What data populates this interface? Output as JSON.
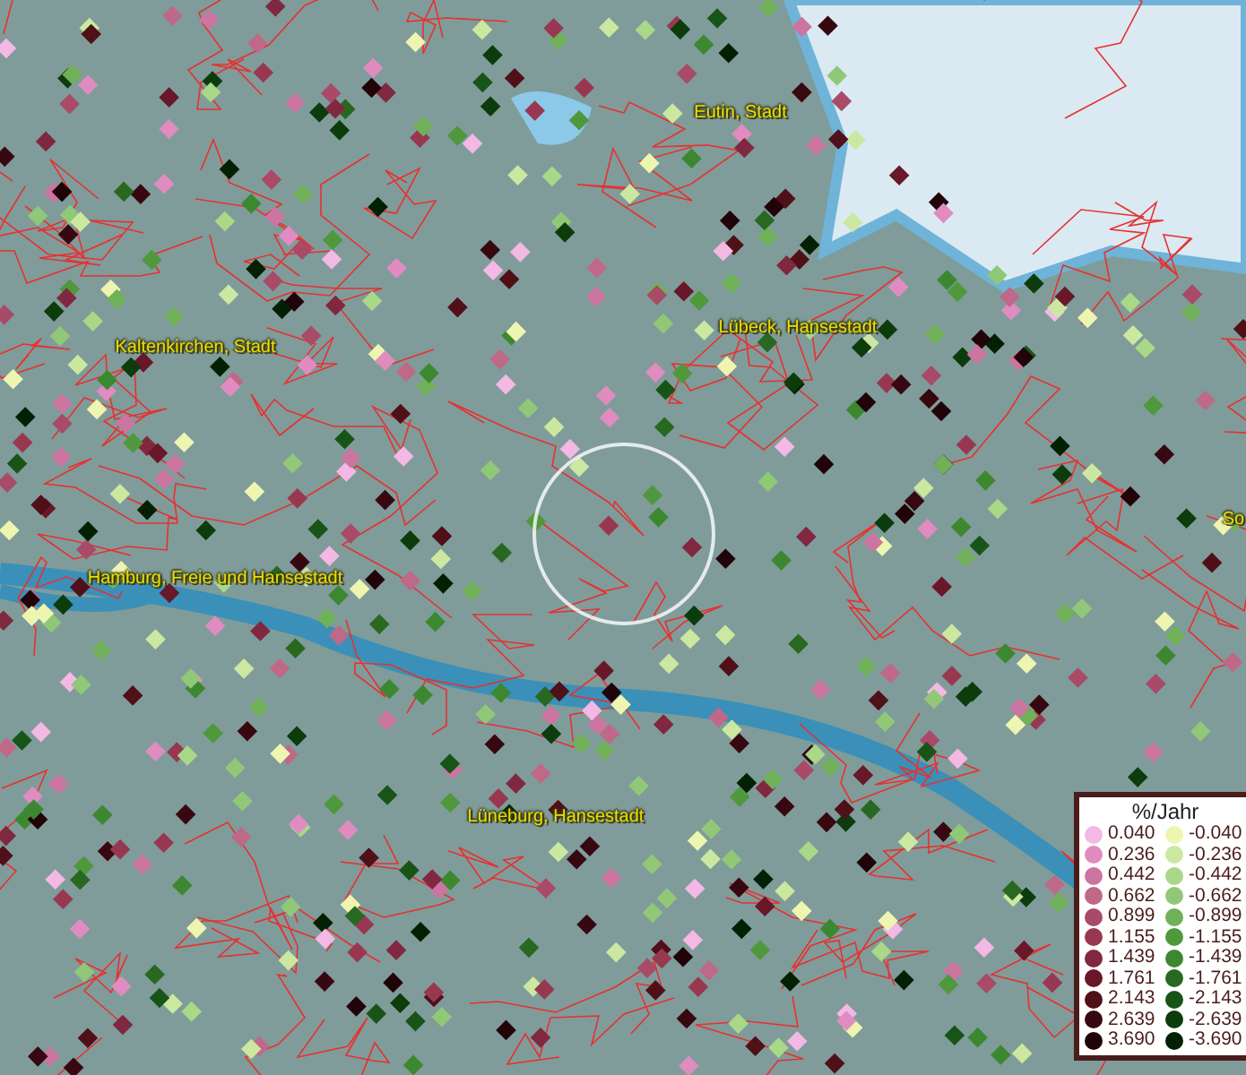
{
  "map": {
    "places": [
      {
        "name": "Eutin, Stadt"
      },
      {
        "name": "Lübeck, Hansestadt"
      },
      {
        "name": "Kaltenkirchen, Stadt"
      },
      {
        "name": "Hamburg, Freie und Hansestadt"
      },
      {
        "name": "Lüneburg, Hansestadt"
      },
      {
        "name": "So"
      }
    ]
  },
  "legend": {
    "title": "%/Jahr",
    "rows": [
      {
        "left": {
          "value": "0.040",
          "color": "#f4b8e4"
        },
        "right": {
          "value": "-0.040",
          "color": "#eef5b0"
        }
      },
      {
        "left": {
          "value": "0.236",
          "color": "#e08cc0"
        },
        "right": {
          "value": "-0.236",
          "color": "#cce8a0"
        }
      },
      {
        "left": {
          "value": "0.442",
          "color": "#cc75a0"
        },
        "right": {
          "value": "-0.442",
          "color": "#a8d888"
        }
      },
      {
        "left": {
          "value": "0.662",
          "color": "#c06888"
        },
        "right": {
          "value": "-0.662",
          "color": "#90c878"
        }
      },
      {
        "left": {
          "value": "0.899",
          "color": "#a84a68"
        },
        "right": {
          "value": "-0.899",
          "color": "#70b058"
        }
      },
      {
        "left": {
          "value": "1.155",
          "color": "#983850"
        },
        "right": {
          "value": "-1.155",
          "color": "#50983c"
        }
      },
      {
        "left": {
          "value": "1.439",
          "color": "#802840"
        },
        "right": {
          "value": "-1.439",
          "color": "#3c8830"
        }
      },
      {
        "left": {
          "value": "1.761",
          "color": "#681828"
        },
        "right": {
          "value": "-1.761",
          "color": "#286820"
        }
      },
      {
        "left": {
          "value": "2.143",
          "color": "#501018"
        },
        "right": {
          "value": "-2.143",
          "color": "#185418"
        }
      },
      {
        "left": {
          "value": "2.639",
          "color": "#380810"
        },
        "right": {
          "value": "-2.639",
          "color": "#0c3c0c"
        }
      },
      {
        "left": {
          "value": "3.690",
          "color": "#200408"
        },
        "right": {
          "value": "-3.690",
          "color": "#042004"
        }
      }
    ]
  }
}
